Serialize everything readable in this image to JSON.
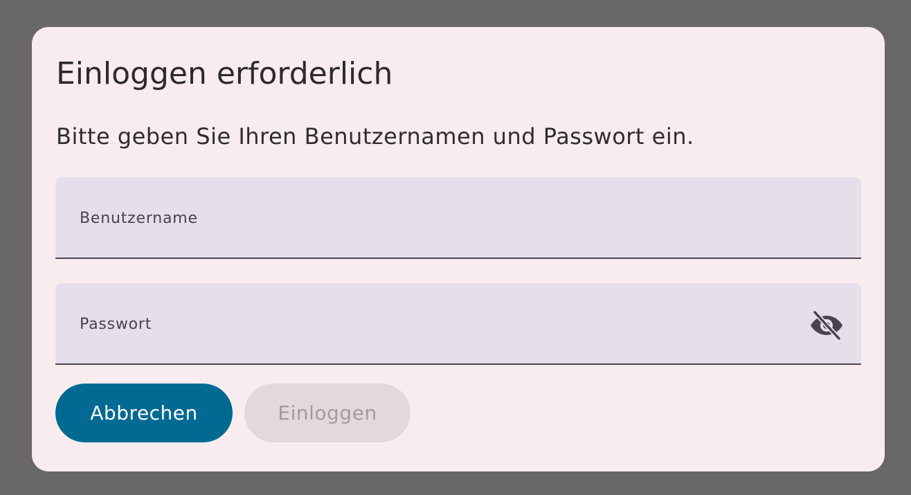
{
  "dialog": {
    "title": "Einloggen erforderlich",
    "message": "Bitte geben Sie Ihren Benutzernamen und Passwort ein.",
    "username": {
      "label": "Benutzername",
      "value": ""
    },
    "password": {
      "label": "Passwort",
      "value": "",
      "visibility_icon": "visibility-off-icon"
    },
    "buttons": {
      "cancel_label": "Abbrechen",
      "login_label": "Einloggen",
      "login_enabled": false
    }
  },
  "colors": {
    "backdrop": "#69676a",
    "dialog_bg": "#f8ecee",
    "field_bg": "#e6dfeb",
    "primary": "#006a93",
    "disabled_bg": "#e3d8da",
    "disabled_text": "#a39c9f"
  }
}
